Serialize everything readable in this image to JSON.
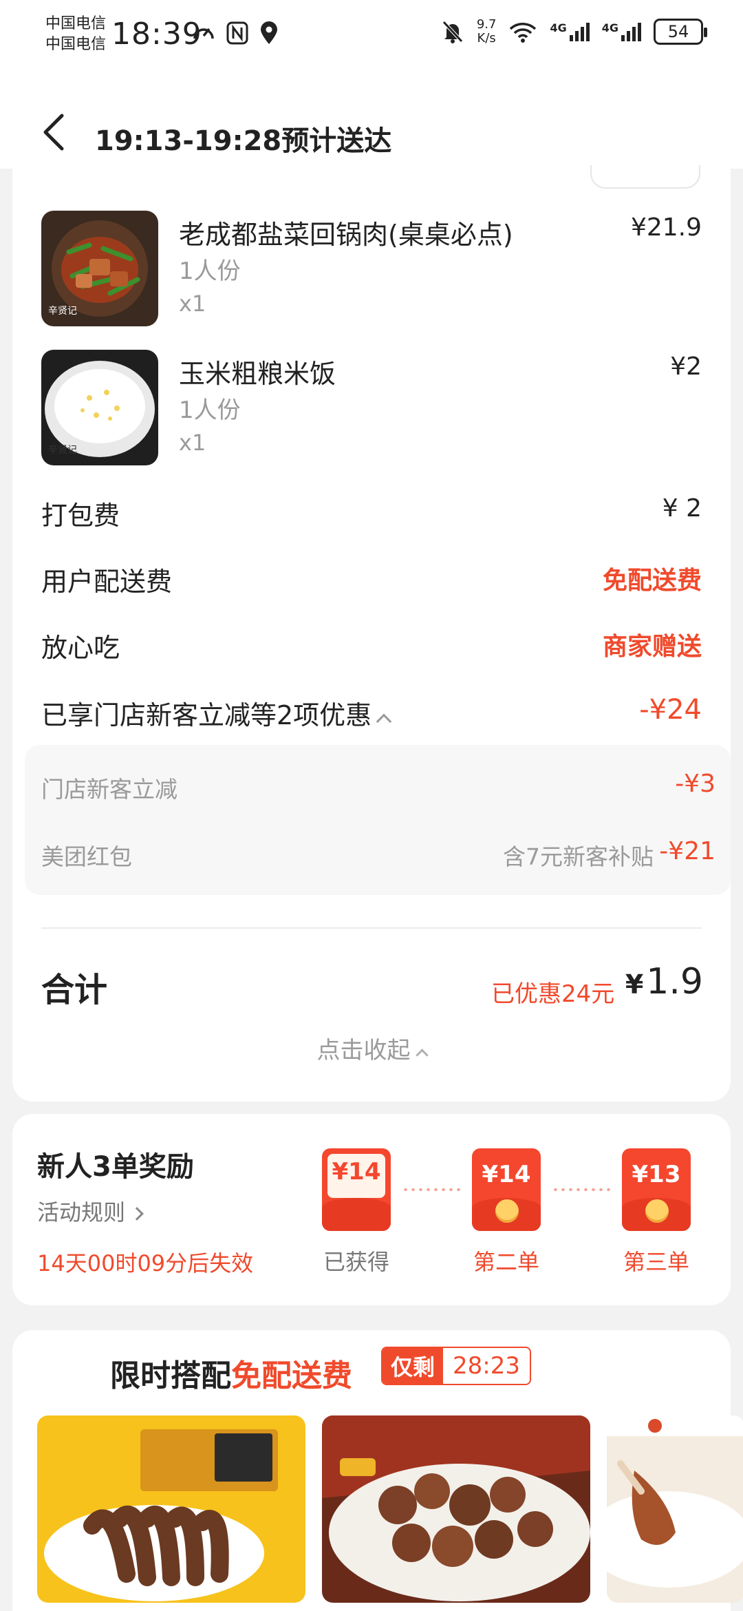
{
  "status_bar": {
    "carrier_1": "中国电信",
    "carrier_2": "中国电信",
    "time": "18:39",
    "speed_value": "9.7",
    "speed_unit": "K/s",
    "net_1": "4G",
    "net_2": "4G",
    "battery": "54"
  },
  "header": {
    "title": "19:13-19:28预计送达"
  },
  "order": {
    "items": [
      {
        "name": "老成都盐菜回锅肉(桌桌必点)",
        "spec": "1人份",
        "qty": "x1",
        "price": "¥21.9"
      },
      {
        "name": "玉米粗粮米饭",
        "spec": "1人份",
        "qty": "x1",
        "price": "¥2"
      }
    ],
    "fees": [
      {
        "label": "打包费",
        "value": "¥ 2"
      },
      {
        "label": "用户配送费",
        "value": "免配送费"
      },
      {
        "label": "放心吃",
        "value": "商家赠送"
      }
    ],
    "discount_summary": {
      "label": "已享门店新客立减等2项优惠",
      "value": "-¥24"
    },
    "discounts": [
      {
        "label": "门店新客立减",
        "note": "",
        "value": "-¥3"
      },
      {
        "label": "美团红包",
        "note": "含7元新客补贴",
        "value": "-¥21"
      }
    ],
    "total_label": "合计",
    "saved_text": "已优惠24元",
    "total_yen": "¥",
    "total_amount": "1.9",
    "collapse_text": "点击收起"
  },
  "reward": {
    "title": "新人3单奖励",
    "rules": "活动规则",
    "expire": "14天00时09分后失效",
    "coupons": [
      {
        "amount": "¥14",
        "label": "已获得"
      },
      {
        "amount": "¥14",
        "label": "第二单"
      },
      {
        "amount": "¥13",
        "label": "第三单"
      }
    ]
  },
  "combo": {
    "title_prefix": "限时搭配",
    "title_highlight": "免配送费",
    "only_left": "仅剩",
    "countdown": "28:23"
  },
  "colors": {
    "accent_red": "#f04a2c",
    "muted_gray": "#9a9a9a",
    "background": "#f2f2f2"
  }
}
